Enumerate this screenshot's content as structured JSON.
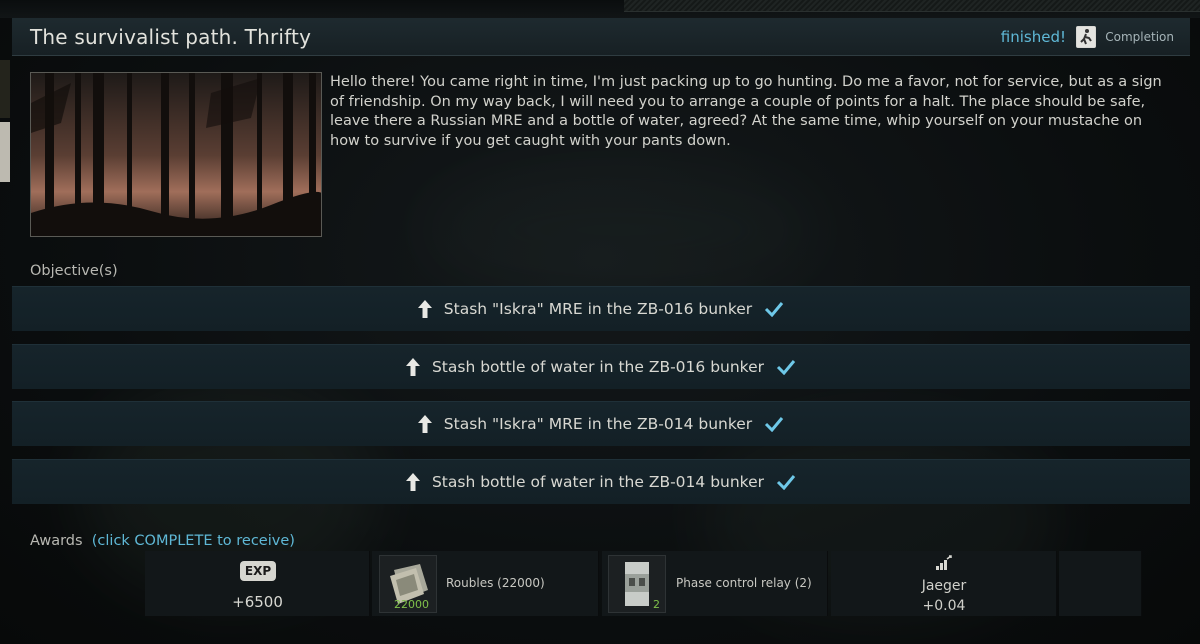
{
  "header": {
    "title": "The survivalist path. Thrifty",
    "status": "finished!",
    "completion_label": "Completion"
  },
  "description": "Hello there! You came right in time, I'm just packing up to go hunting. Do me a favor, not for service, but as a sign of friendship. On my way back, I will need you to arrange a couple of points for a halt. The place should be safe, leave there a Russian MRE and a bottle of water, agreed? At the same time, whip yourself on your mustache on how to survive if you get caught with your pants down.",
  "objectives": {
    "heading": "Objective(s)",
    "items": [
      {
        "label": "Stash \"Iskra\" MRE in the ZB-016 bunker"
      },
      {
        "label": "Stash bottle of water in the ZB-016 bunker"
      },
      {
        "label": "Stash \"Iskra\" MRE in the ZB-014 bunker"
      },
      {
        "label": "Stash bottle of water in the ZB-014 bunker"
      }
    ]
  },
  "awards": {
    "heading": "Awards",
    "hint": "(click COMPLETE to receive)",
    "exp_badge": "EXP",
    "exp_value": "+6500",
    "roubles_label": "Roubles (22000)",
    "roubles_count": "22000",
    "relay_label": "Phase control relay (2)",
    "relay_count": "2",
    "trader_name": "Jaeger",
    "trader_rep": "+0.04"
  },
  "icons": {
    "objective": "up-arrow-icon",
    "check": "checkmark-icon",
    "completion": "exit-door-icon",
    "reputation": "signal-bars-icon"
  },
  "colors": {
    "accent": "#5fb8d6",
    "objective_bg": "#16242b"
  }
}
